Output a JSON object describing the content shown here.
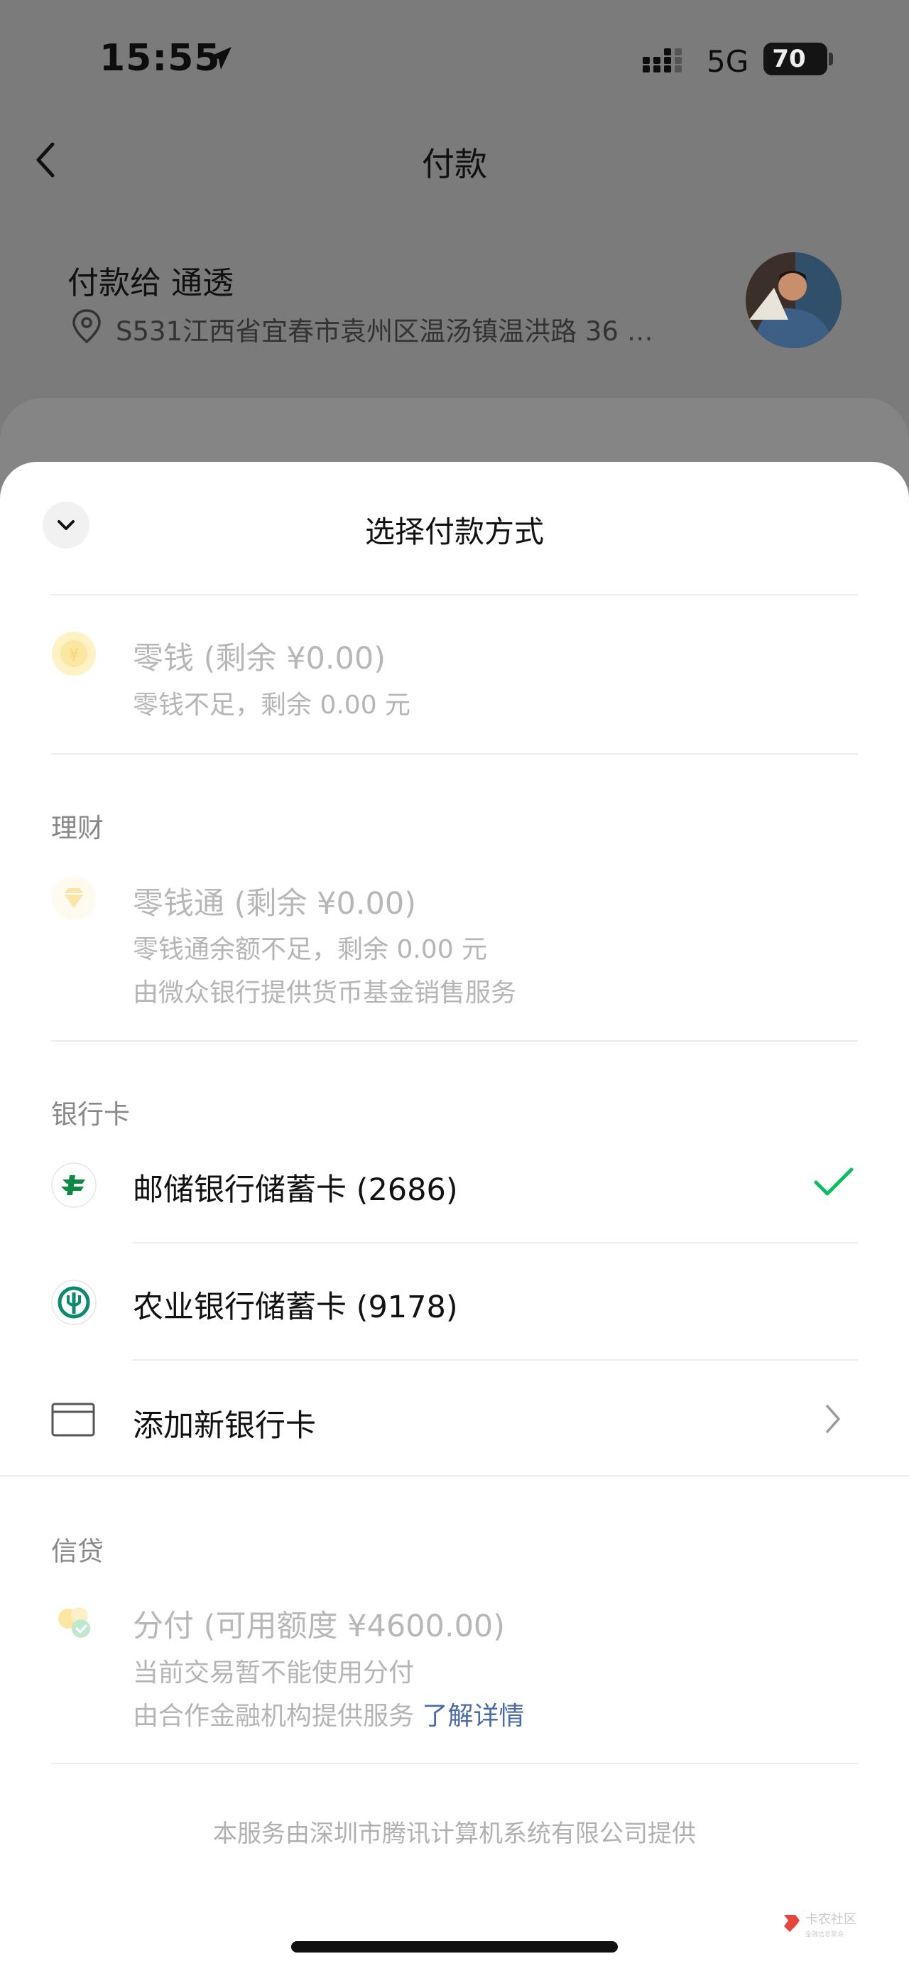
{
  "status_bar": {
    "time": "15:55",
    "network": "5G",
    "battery": "70"
  },
  "nav": {
    "title": "付款"
  },
  "payee": {
    "title": "付款给 通透",
    "address": "S531江西省宜春市袁州区温汤镇温洪路 36 …"
  },
  "sheet": {
    "title": "选择付款方式",
    "change": {
      "name": "零钱 (剩余 ¥0.00)",
      "note": "零钱不足，剩余 0.00 元"
    },
    "wealth": {
      "section": "理财",
      "name": "零钱通 (剩余 ¥0.00)",
      "note": "零钱通余额不足，剩余 0.00 元",
      "provider": "由微众银行提供货币基金销售服务"
    },
    "bank_cards": {
      "section": "银行卡",
      "cards": [
        {
          "name": "邮储银行储蓄卡 (2686)",
          "selected": true
        },
        {
          "name": "农业银行储蓄卡 (9178)",
          "selected": false
        }
      ],
      "add_label": "添加新银行卡"
    },
    "credit": {
      "section": "信贷",
      "name": "分付 (可用额度 ¥4600.00)",
      "note": "当前交易暂不能使用分付",
      "provider": "由合作金融机构提供服务",
      "link": "了解详情"
    },
    "footer": "本服务由深圳市腾讯计算机系统有限公司提供"
  },
  "watermark": {
    "text": "卡农社区",
    "subtext": "金融信息聚合"
  },
  "colors": {
    "accent_green": "#07c160",
    "link_blue": "#4a6aa8",
    "overlay_gray": "#7b7b7b"
  },
  "icons": [
    "location-arrow-icon",
    "signal-icon",
    "back-chevron-icon",
    "map-pin-icon",
    "chevron-down-icon",
    "coin-icon",
    "diamond-icon",
    "postal-bank-icon",
    "abc-bank-icon",
    "card-outline-icon",
    "chevron-right-icon",
    "checkmark-icon",
    "credit-icon"
  ]
}
